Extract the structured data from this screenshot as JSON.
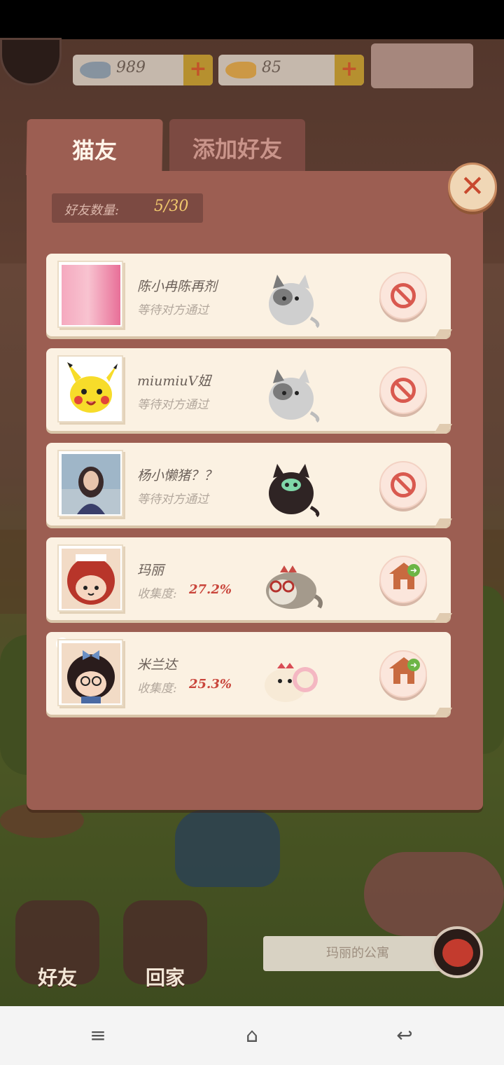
{
  "top_bar": {
    "coins_fish_silver": "989",
    "coins_fish_gold": "85",
    "plus_label": "+"
  },
  "tabs": [
    {
      "label": "猫友",
      "active": true
    },
    {
      "label": "添加好友",
      "active": false
    }
  ],
  "close_label": "✕",
  "friend_count": {
    "label": "好友数量:",
    "value": "5/30"
  },
  "friends": [
    {
      "name": "陈小冉陈再剂",
      "status": "等待对方通过",
      "action": "cancel",
      "cat": "grey-white"
    },
    {
      "name": "miumiuV妞",
      "status": "等待对方通过",
      "action": "cancel",
      "cat": "grey-white"
    },
    {
      "name": "杨小懒猪？？",
      "status": "等待对方通过",
      "action": "cancel",
      "cat": "black"
    },
    {
      "name": "玛丽",
      "collect_label": "收集度:",
      "collect_value": "27.2%",
      "action": "visit-home",
      "cat": "glasses-tabby"
    },
    {
      "name": "米兰达",
      "collect_label": "收集度:",
      "collect_value": "25.3%",
      "action": "visit-home",
      "cat": "cream-bow",
      "has_new": true
    }
  ],
  "hud": {
    "friends_label": "好友",
    "home_label": "回家",
    "location_label": "玛丽的公寓"
  },
  "nav": {
    "menu_icon": "≡",
    "home_icon": "⌂",
    "back_icon": "↩"
  },
  "colors": {
    "panel": "#9c5e52",
    "card": "#fbf1e2",
    "accent_red": "#d9594f",
    "gold": "#f1c86e"
  }
}
